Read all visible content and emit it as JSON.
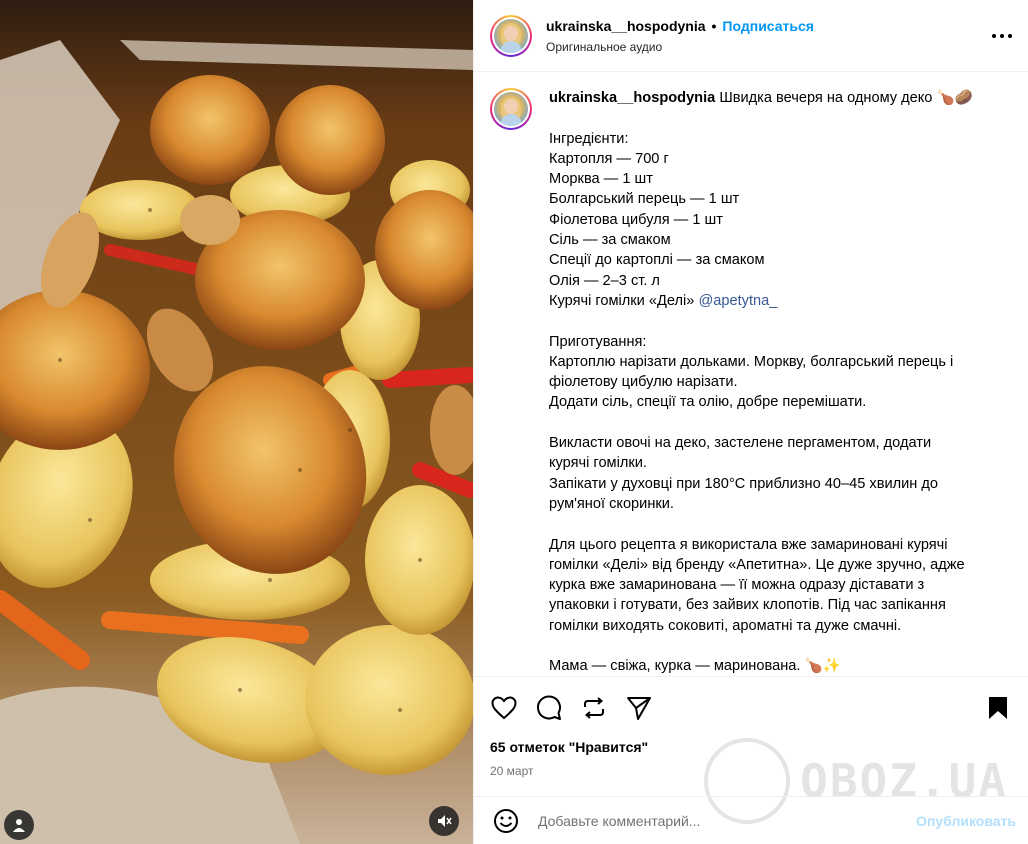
{
  "post": {
    "username": "ukrainska__hospodynia",
    "follow_label": "Подписаться",
    "audio": "Оригинальное аудио",
    "more_icon": "more-horizontal-icon"
  },
  "caption": {
    "username": "ukrainska__hospodynia",
    "title": "Швидка вечеря на одному деко 🍗🥔",
    "lines": [
      "Інгредієнти:",
      "Картопля — 700 г",
      "Морква — 1 шт",
      "Болгарський перець — 1 шт",
      "Фіолетова цибуля — 1 шт",
      "Сіль — за смаком",
      "Спеції до картоплі — за смаком",
      "Олія — 2–3 ст. л",
      "Курячі гомілки «Делі» ",
      "",
      "Приготування:",
      "Картоплю нарізати дольками. Моркву, болгарський перець і",
      "фіолетову цибулю нарізати.",
      "Додати сіль, спеції та олію, добре перемішати.",
      "",
      "Викласти овочі на деко, застелене пергаментом, додати",
      "курячі гомілки.",
      "Запікати у духовці при 180°С приблизно 40–45 хвилин до",
      "рум'яної скоринки.",
      "",
      "Для цього рецепта я використала вже замариновані курячі",
      "гомілки «Делі» від бренду «Апетитна». Це дуже зручно, адже",
      "курка вже замаринована — її можна одразу діставати з",
      "упаковки і готувати, без зайвих клопотів. Під час запікання",
      "гомілки виходять соковиті, ароматні та дуже смачні.",
      "",
      "Мама — свіжа, курка — маринована. 🍗✨"
    ],
    "mention": "@apetytna_"
  },
  "actions": {
    "like_icon": "heart-icon",
    "comment_icon": "comment-icon",
    "repost_icon": "repost-icon",
    "share_icon": "send-icon",
    "save_icon": "bookmark-icon",
    "likes": "65 отметок \"Нравится\"",
    "date": "20 март"
  },
  "comment_box": {
    "emoji_icon": "emoji-icon",
    "placeholder": "Добавьте комментарий...",
    "post_label": "Опубликовать"
  },
  "watermark": {
    "text": "OBOZ.UA"
  },
  "media": {
    "tag_icon": "user-tag-icon",
    "mute_icon": "speaker-muted-icon"
  },
  "colors": {
    "accent": "#0095f6",
    "post_disabled": "#b2dffc",
    "mention": "#385898"
  }
}
